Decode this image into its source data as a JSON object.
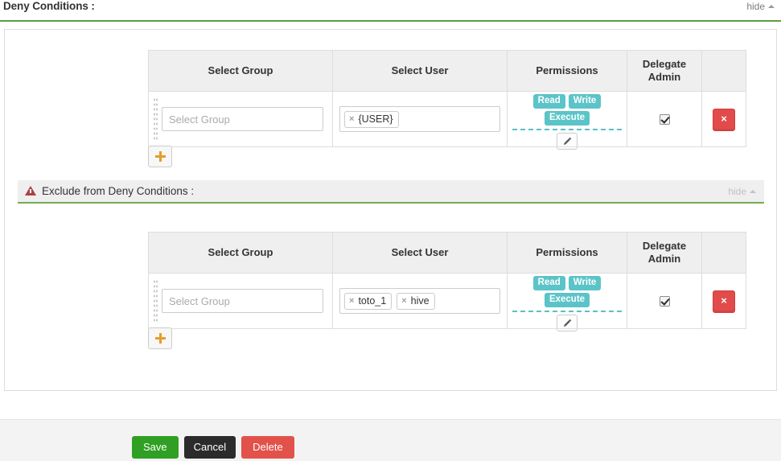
{
  "deny_section": {
    "title": "Deny Conditions :",
    "hide_label": "hide",
    "accent_color": "#5e9e3f"
  },
  "exclude_section": {
    "title": "Exclude from Deny Conditions :",
    "hide_label": "hide",
    "warning_icon": "warning-triangle-icon",
    "accent_color": "#76ad52"
  },
  "table": {
    "columns": [
      {
        "label": "Select Group"
      },
      {
        "label": "Select User"
      },
      {
        "label": "Permissions"
      },
      {
        "label": "Delegate\nAdmin"
      },
      {
        "label": ""
      }
    ],
    "delegate_admin_label_line1": "Delegate",
    "delegate_admin_label_line2": "Admin"
  },
  "deny_rows": [
    {
      "group_placeholder": "Select Group",
      "group_value": "",
      "users": [
        "{USER}"
      ],
      "permissions": [
        "Read",
        "Write",
        "Execute"
      ],
      "delegate_admin": true,
      "remove_label": "×"
    }
  ],
  "exclude_rows": [
    {
      "group_placeholder": "Select Group",
      "group_value": "",
      "users": [
        "toto_1",
        "hive"
      ],
      "permissions": [
        "Read",
        "Write",
        "Execute"
      ],
      "delegate_admin": true,
      "remove_label": "×"
    }
  ],
  "add_button": {
    "label": "+",
    "icon": "plus-icon"
  },
  "edit_button": {
    "icon": "pencil-icon"
  },
  "tag_remove_glyph": "×",
  "footer": {
    "save_label": "Save",
    "cancel_label": "Cancel",
    "delete_label": "Delete"
  },
  "colors": {
    "badge_teal": "#5bc4c8",
    "save_green": "#2fa023",
    "cancel_black": "#2b2b2b",
    "delete_red": "#e2514a",
    "remove_red": "#e24b4b",
    "plus_orange": "#e59c2b",
    "rule_green": "#6aa84f",
    "warning_red": "#a94442"
  }
}
